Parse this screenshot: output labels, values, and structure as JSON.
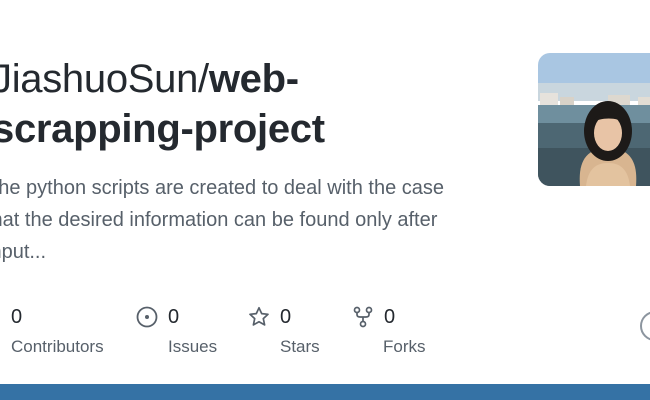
{
  "repo": {
    "owner": "JiashuoSun/",
    "name_line1": "web-",
    "name_line2": "scrapping-project",
    "description_lines": [
      "The python scripts are created to deal with the case",
      "that the desired information can be found only after",
      "input..."
    ]
  },
  "stats": [
    {
      "value": "0",
      "label": "Contributors",
      "icon": "contributors-icon"
    },
    {
      "value": "0",
      "label": "Issues",
      "icon": "issue-icon"
    },
    {
      "value": "0",
      "label": "Stars",
      "icon": "star-icon"
    },
    {
      "value": "0",
      "label": "Forks",
      "icon": "fork-icon"
    }
  ],
  "colors": {
    "language_bar": "#3572a5",
    "text_primary": "#24292f",
    "text_muted": "#57606a"
  }
}
